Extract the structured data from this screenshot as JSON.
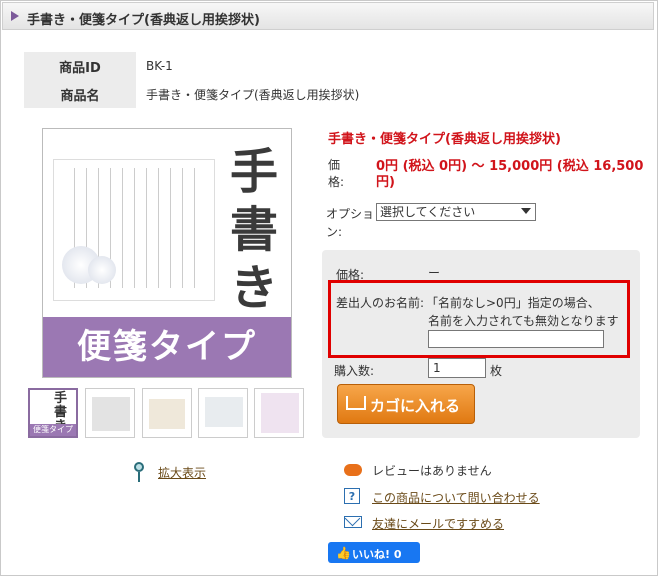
{
  "title": "手書き・便箋タイプ(香典返し用挨拶状)",
  "info": {
    "id_label": "商品ID",
    "id_value": "BK-1",
    "name_label": "商品名",
    "name_value": "手書き・便箋タイプ(香典返し用挨拶状)"
  },
  "main_image": {
    "kanji": "手書き",
    "band": "便箋タイプ"
  },
  "thumbnails": [
    {
      "kanji": "手書き",
      "band": "便箋タイプ"
    },
    {},
    {},
    {},
    {}
  ],
  "zoom_label": "拡大表示",
  "product": {
    "name": "手書き・便箋タイプ(香典返し用挨拶状)",
    "price_label": "価格:",
    "price_value": "0円 (税込 0円) 〜 15,000円 (税込 16,500円)",
    "option_label": "オプション:",
    "option_selected": "選択してください"
  },
  "cart": {
    "price_label": "価格:",
    "price_value": "ー",
    "sender_label": "差出人のお名前:",
    "sender_note1": "「名前なし>0円」指定の場合、",
    "sender_note2": "名前を入力されても無効となります",
    "sender_value": "",
    "qty_label": "購入数:",
    "qty_value": "1",
    "qty_unit": "枚",
    "add_button": "カゴに入れる"
  },
  "links": {
    "review": "レビューはありません",
    "inquiry": "この商品について問い合わせる",
    "mail": "友達にメールですすめる"
  },
  "like": {
    "label": "いいね!",
    "count": "0"
  }
}
